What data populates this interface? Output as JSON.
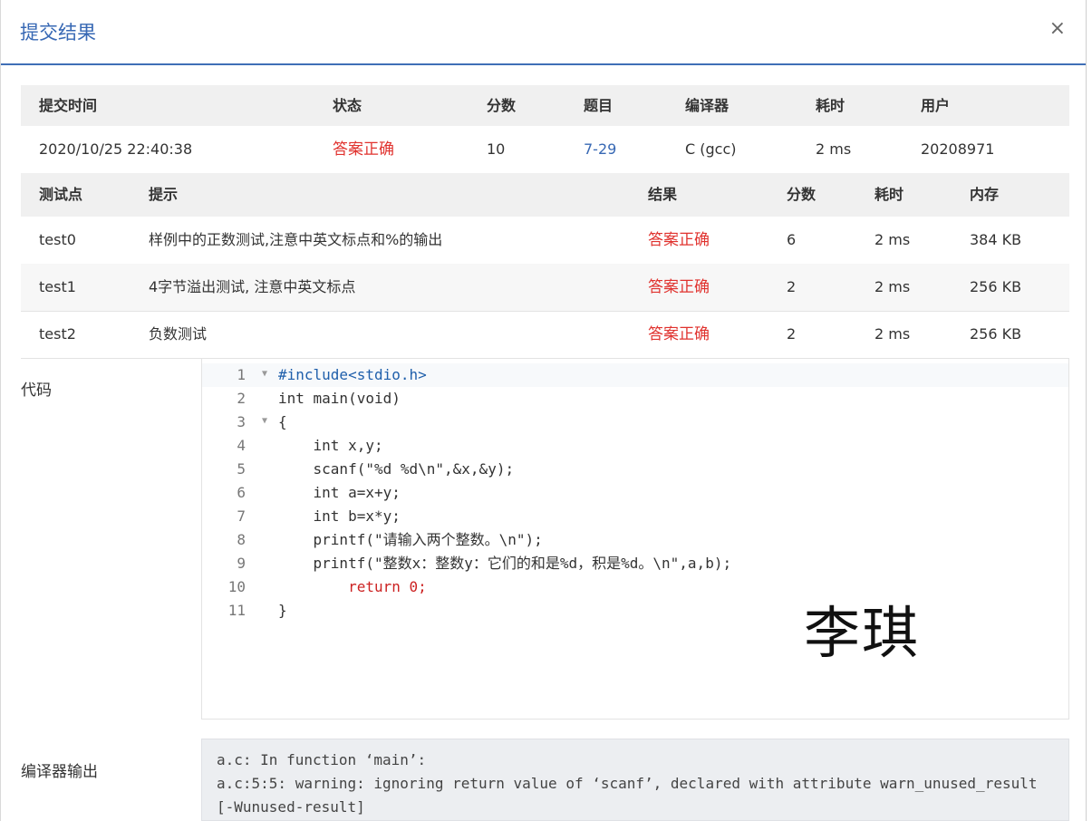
{
  "dialog": {
    "title": "提交结果",
    "close_glyph": "×"
  },
  "summary": {
    "headers": [
      "提交时间",
      "状态",
      "分数",
      "题目",
      "编译器",
      "耗时",
      "用户"
    ],
    "row": {
      "time": "2020/10/25 22:40:38",
      "status": "答案正确",
      "score": "10",
      "problem": "7-29",
      "compiler": "C (gcc)",
      "duration": "2 ms",
      "user": "20208971"
    }
  },
  "tests": {
    "headers": [
      "测试点",
      "提示",
      "结果",
      "分数",
      "耗时",
      "内存"
    ],
    "rows": [
      {
        "name": "test0",
        "hint": "样例中的正数测试,注意中英文标点和%的输出",
        "result": "答案正确",
        "score": "6",
        "time": "2 ms",
        "memory": "384 KB"
      },
      {
        "name": "test1",
        "hint": "4字节溢出测试, 注意中英文标点",
        "result": "答案正确",
        "score": "2",
        "time": "2 ms",
        "memory": "256 KB"
      },
      {
        "name": "test2",
        "hint": "负数测试",
        "result": "答案正确",
        "score": "2",
        "time": "2 ms",
        "memory": "256 KB"
      }
    ]
  },
  "code": {
    "label": "代码",
    "line_numbers": [
      "1",
      "2",
      "3",
      "4",
      "5",
      "6",
      "7",
      "8",
      "9",
      "10",
      "11"
    ],
    "lines": [
      "#include<stdio.h>",
      "int main(void)",
      "{",
      "    int x,y;",
      "    scanf(\"%d %d\\n\",&x,&y);",
      "    int a=x+y;",
      "    int b=x*y;",
      "    printf(\"请输入两个整数。\\n\");",
      "    printf(\"整数x：整数y：它们的和是%d，积是%d。\\n\",a,b);",
      "        return 0;",
      "}"
    ],
    "signature": "李琪"
  },
  "compiler_output": {
    "label": "编译器输出",
    "lines": [
      "a.c: In function ‘main’:",
      "a.c:5:5: warning: ignoring return value of ‘scanf’, declared with attribute warn_unused_result",
      "[-Wunused-result]"
    ]
  },
  "colors": {
    "accent": "#3768b4",
    "success": "#e0322e"
  }
}
